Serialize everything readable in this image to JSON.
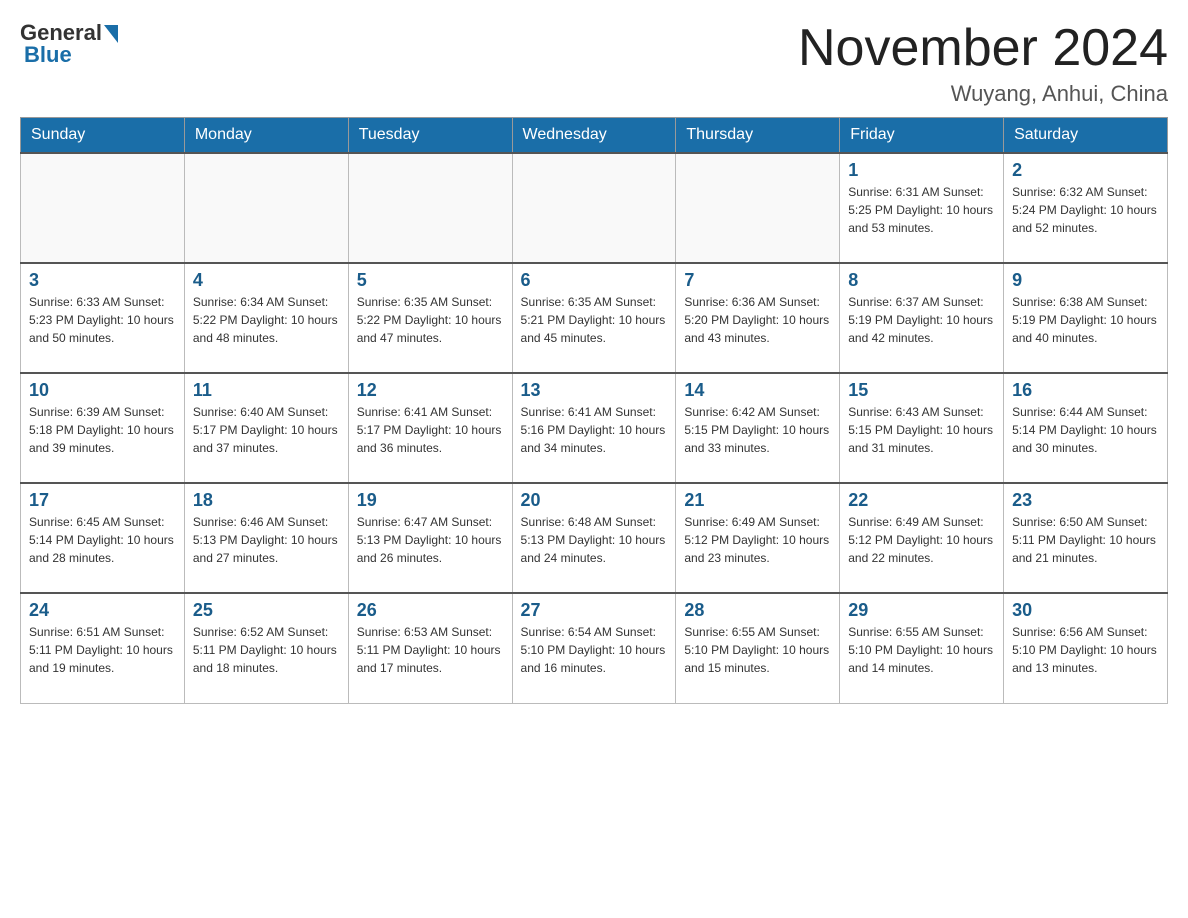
{
  "header": {
    "title": "November 2024",
    "location": "Wuyang, Anhui, China",
    "logo_general": "General",
    "logo_blue": "Blue"
  },
  "weekdays": [
    "Sunday",
    "Monday",
    "Tuesday",
    "Wednesday",
    "Thursday",
    "Friday",
    "Saturday"
  ],
  "weeks": [
    [
      {
        "day": "",
        "info": ""
      },
      {
        "day": "",
        "info": ""
      },
      {
        "day": "",
        "info": ""
      },
      {
        "day": "",
        "info": ""
      },
      {
        "day": "",
        "info": ""
      },
      {
        "day": "1",
        "info": "Sunrise: 6:31 AM\nSunset: 5:25 PM\nDaylight: 10 hours and 53 minutes."
      },
      {
        "day": "2",
        "info": "Sunrise: 6:32 AM\nSunset: 5:24 PM\nDaylight: 10 hours and 52 minutes."
      }
    ],
    [
      {
        "day": "3",
        "info": "Sunrise: 6:33 AM\nSunset: 5:23 PM\nDaylight: 10 hours and 50 minutes."
      },
      {
        "day": "4",
        "info": "Sunrise: 6:34 AM\nSunset: 5:22 PM\nDaylight: 10 hours and 48 minutes."
      },
      {
        "day": "5",
        "info": "Sunrise: 6:35 AM\nSunset: 5:22 PM\nDaylight: 10 hours and 47 minutes."
      },
      {
        "day": "6",
        "info": "Sunrise: 6:35 AM\nSunset: 5:21 PM\nDaylight: 10 hours and 45 minutes."
      },
      {
        "day": "7",
        "info": "Sunrise: 6:36 AM\nSunset: 5:20 PM\nDaylight: 10 hours and 43 minutes."
      },
      {
        "day": "8",
        "info": "Sunrise: 6:37 AM\nSunset: 5:19 PM\nDaylight: 10 hours and 42 minutes."
      },
      {
        "day": "9",
        "info": "Sunrise: 6:38 AM\nSunset: 5:19 PM\nDaylight: 10 hours and 40 minutes."
      }
    ],
    [
      {
        "day": "10",
        "info": "Sunrise: 6:39 AM\nSunset: 5:18 PM\nDaylight: 10 hours and 39 minutes."
      },
      {
        "day": "11",
        "info": "Sunrise: 6:40 AM\nSunset: 5:17 PM\nDaylight: 10 hours and 37 minutes."
      },
      {
        "day": "12",
        "info": "Sunrise: 6:41 AM\nSunset: 5:17 PM\nDaylight: 10 hours and 36 minutes."
      },
      {
        "day": "13",
        "info": "Sunrise: 6:41 AM\nSunset: 5:16 PM\nDaylight: 10 hours and 34 minutes."
      },
      {
        "day": "14",
        "info": "Sunrise: 6:42 AM\nSunset: 5:15 PM\nDaylight: 10 hours and 33 minutes."
      },
      {
        "day": "15",
        "info": "Sunrise: 6:43 AM\nSunset: 5:15 PM\nDaylight: 10 hours and 31 minutes."
      },
      {
        "day": "16",
        "info": "Sunrise: 6:44 AM\nSunset: 5:14 PM\nDaylight: 10 hours and 30 minutes."
      }
    ],
    [
      {
        "day": "17",
        "info": "Sunrise: 6:45 AM\nSunset: 5:14 PM\nDaylight: 10 hours and 28 minutes."
      },
      {
        "day": "18",
        "info": "Sunrise: 6:46 AM\nSunset: 5:13 PM\nDaylight: 10 hours and 27 minutes."
      },
      {
        "day": "19",
        "info": "Sunrise: 6:47 AM\nSunset: 5:13 PM\nDaylight: 10 hours and 26 minutes."
      },
      {
        "day": "20",
        "info": "Sunrise: 6:48 AM\nSunset: 5:13 PM\nDaylight: 10 hours and 24 minutes."
      },
      {
        "day": "21",
        "info": "Sunrise: 6:49 AM\nSunset: 5:12 PM\nDaylight: 10 hours and 23 minutes."
      },
      {
        "day": "22",
        "info": "Sunrise: 6:49 AM\nSunset: 5:12 PM\nDaylight: 10 hours and 22 minutes."
      },
      {
        "day": "23",
        "info": "Sunrise: 6:50 AM\nSunset: 5:11 PM\nDaylight: 10 hours and 21 minutes."
      }
    ],
    [
      {
        "day": "24",
        "info": "Sunrise: 6:51 AM\nSunset: 5:11 PM\nDaylight: 10 hours and 19 minutes."
      },
      {
        "day": "25",
        "info": "Sunrise: 6:52 AM\nSunset: 5:11 PM\nDaylight: 10 hours and 18 minutes."
      },
      {
        "day": "26",
        "info": "Sunrise: 6:53 AM\nSunset: 5:11 PM\nDaylight: 10 hours and 17 minutes."
      },
      {
        "day": "27",
        "info": "Sunrise: 6:54 AM\nSunset: 5:10 PM\nDaylight: 10 hours and 16 minutes."
      },
      {
        "day": "28",
        "info": "Sunrise: 6:55 AM\nSunset: 5:10 PM\nDaylight: 10 hours and 15 minutes."
      },
      {
        "day": "29",
        "info": "Sunrise: 6:55 AM\nSunset: 5:10 PM\nDaylight: 10 hours and 14 minutes."
      },
      {
        "day": "30",
        "info": "Sunrise: 6:56 AM\nSunset: 5:10 PM\nDaylight: 10 hours and 13 minutes."
      }
    ]
  ]
}
